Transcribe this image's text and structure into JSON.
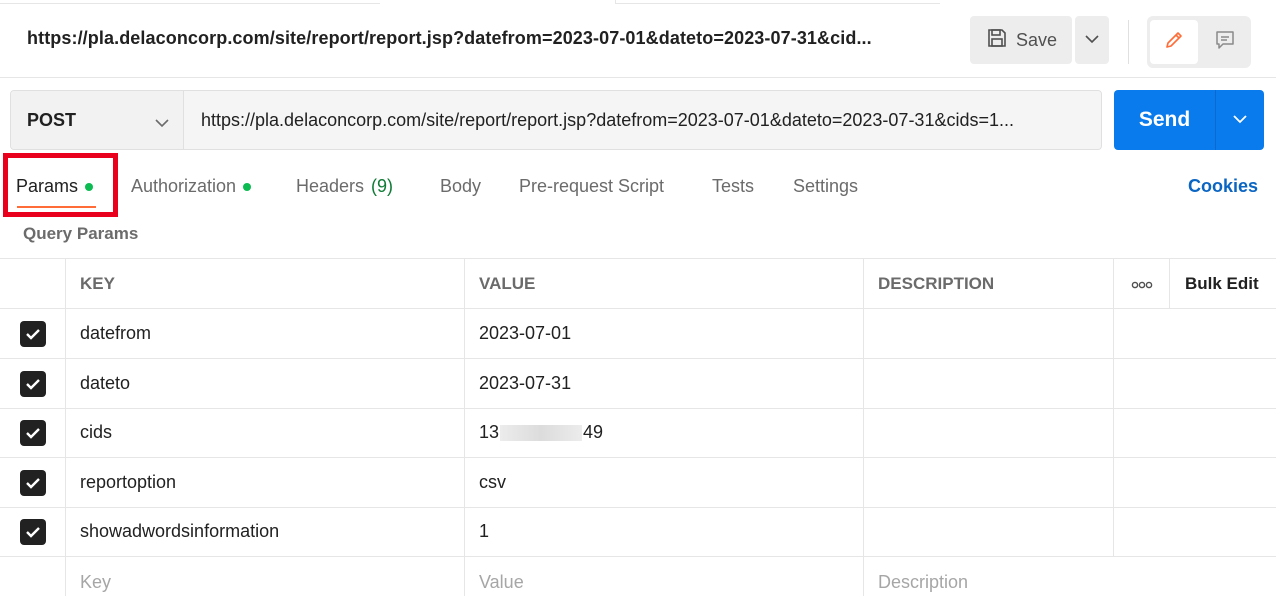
{
  "header": {
    "request_title": "https://pla.delaconcorp.com/site/report/report.jsp?datefrom=2023-07-01&dateto=2023-07-31&cid...",
    "save_label": "Save",
    "save_icon": "floppy-disk-icon",
    "edit_icon": "pencil-icon",
    "comment_icon": "comment-icon",
    "accent_color": "#ff6c37"
  },
  "request": {
    "method": "POST",
    "url": "https://pla.delaconcorp.com/site/report/report.jsp?datefrom=2023-07-01&dateto=2023-07-31&cids=1...",
    "send_label": "Send",
    "send_color": "#097bed"
  },
  "tabs": [
    {
      "label": "Params",
      "dot": true,
      "active": true
    },
    {
      "label": "Authorization",
      "dot": true
    },
    {
      "label": "Headers",
      "count": "(9)"
    },
    {
      "label": "Body"
    },
    {
      "label": "Pre-request Script"
    },
    {
      "label": "Tests"
    },
    {
      "label": "Settings"
    }
  ],
  "cookies_label": "Cookies",
  "query_params": {
    "section_label": "Query Params",
    "columns": {
      "key": "KEY",
      "value": "VALUE",
      "description": "DESCRIPTION",
      "more": "ooo",
      "bulk_edit": "Bulk Edit"
    },
    "rows": [
      {
        "key": "datefrom",
        "value": "2023-07-01",
        "checked": true
      },
      {
        "key": "dateto",
        "value": "2023-07-31",
        "checked": true
      },
      {
        "key": "cids",
        "value_prefix": "13",
        "value_suffix": "49",
        "checked": true
      },
      {
        "key": "reportoption",
        "value": "csv",
        "checked": true
      },
      {
        "key": "showadwordsinformation",
        "value": "1",
        "checked": true
      }
    ],
    "placeholder": {
      "key": "Key",
      "value": "Value",
      "description": "Description"
    }
  }
}
